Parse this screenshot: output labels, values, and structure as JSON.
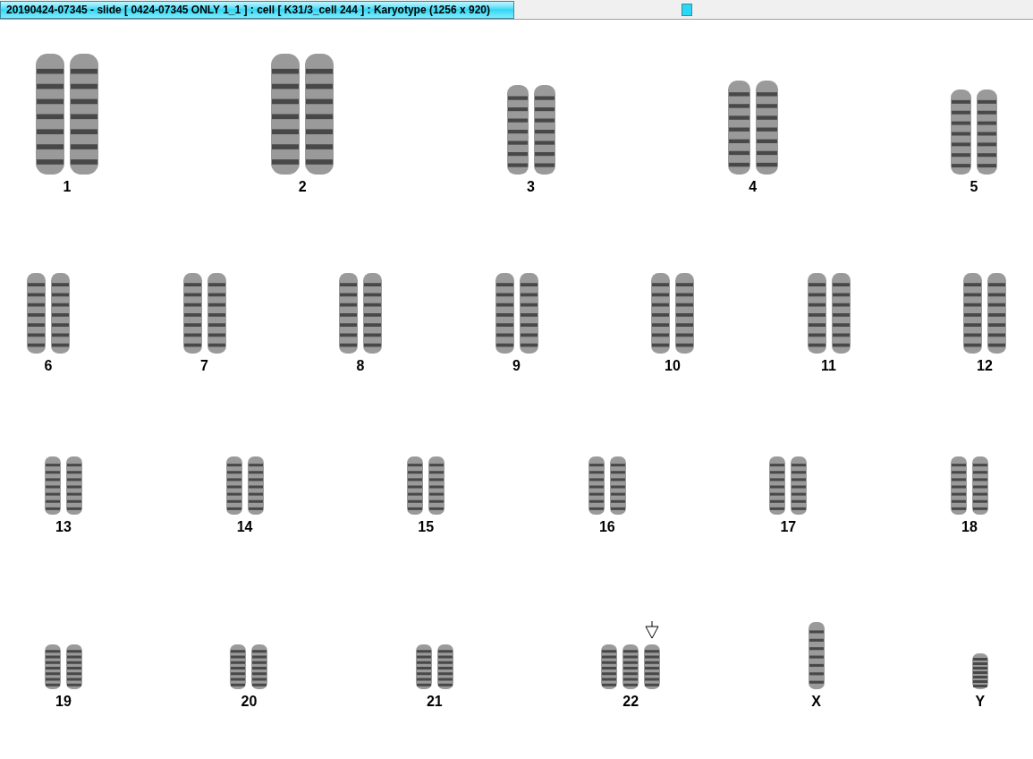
{
  "window": {
    "title": "20190424-07345 - slide [ 0424-07345 ONLY 1_1 ] : cell [ K31/3_cell 244 ] : Karyotype  (1256 x 920)"
  },
  "rows": [
    [
      {
        "label": "1",
        "extra_copy": false,
        "marked": false
      },
      {
        "label": "2",
        "extra_copy": false,
        "marked": false
      },
      {
        "label": "3",
        "extra_copy": false,
        "marked": false
      },
      {
        "label": "4",
        "extra_copy": false,
        "marked": false
      },
      {
        "label": "5",
        "extra_copy": false,
        "marked": false
      }
    ],
    [
      {
        "label": "6",
        "extra_copy": false,
        "marked": false
      },
      {
        "label": "7",
        "extra_copy": false,
        "marked": false
      },
      {
        "label": "8",
        "extra_copy": false,
        "marked": false
      },
      {
        "label": "9",
        "extra_copy": false,
        "marked": false
      },
      {
        "label": "10",
        "extra_copy": false,
        "marked": false
      },
      {
        "label": "11",
        "extra_copy": false,
        "marked": false
      },
      {
        "label": "12",
        "extra_copy": false,
        "marked": false
      }
    ],
    [
      {
        "label": "13",
        "extra_copy": false,
        "marked": false
      },
      {
        "label": "14",
        "extra_copy": false,
        "marked": false
      },
      {
        "label": "15",
        "extra_copy": false,
        "marked": false
      },
      {
        "label": "16",
        "extra_copy": false,
        "marked": false
      },
      {
        "label": "17",
        "extra_copy": false,
        "marked": false
      },
      {
        "label": "18",
        "extra_copy": false,
        "marked": false
      }
    ],
    [
      {
        "label": "19",
        "extra_copy": false,
        "marked": false
      },
      {
        "label": "20",
        "extra_copy": false,
        "marked": false
      },
      {
        "label": "21",
        "extra_copy": false,
        "marked": false
      },
      {
        "label": "22",
        "extra_copy": true,
        "marked": true
      },
      {
        "label": "X",
        "kind": "single",
        "extra_copy": false,
        "marked": false
      },
      {
        "label": "Y",
        "kind": "single",
        "extra_copy": false,
        "marked": false
      }
    ]
  ]
}
